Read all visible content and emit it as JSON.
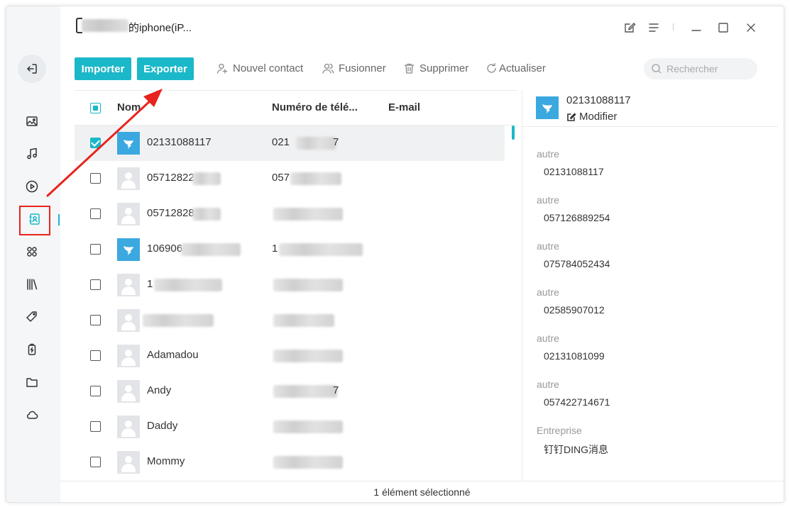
{
  "title": {
    "device_name": "的iphone(iP..."
  },
  "toolbar": {
    "import_label": "Importer",
    "export_label": "Exporter",
    "new_contact_label": "Nouvel contact",
    "merge_label": "Fusionner",
    "delete_label": "Supprimer",
    "refresh_label": "Actualiser",
    "search_placeholder": "Rechercher"
  },
  "sidebar": {
    "items": [
      {
        "icon": "back-icon"
      },
      {
        "icon": "photos-icon"
      },
      {
        "icon": "music-icon"
      },
      {
        "icon": "video-icon"
      },
      {
        "icon": "contacts-icon",
        "active": true
      },
      {
        "icon": "apps-icon"
      },
      {
        "icon": "books-icon"
      },
      {
        "icon": "ringtone-icon"
      },
      {
        "icon": "battery-icon"
      },
      {
        "icon": "folder-icon"
      },
      {
        "icon": "cloud-icon"
      }
    ]
  },
  "list": {
    "headers": {
      "name": "Nom",
      "phone": "Numéro de télé...",
      "email": "E-mail"
    },
    "rows": [
      {
        "name": "02131088117",
        "phone": "021",
        "phone_tail": "7",
        "checked": true,
        "avatar": "brand"
      },
      {
        "name": "05712822",
        "phone": "057",
        "phone_tail": "",
        "checked": false,
        "avatar": "default"
      },
      {
        "name": "05712828",
        "phone": "",
        "phone_tail": "",
        "checked": false,
        "avatar": "default"
      },
      {
        "name": "106906",
        "phone": "1",
        "phone_tail": "",
        "checked": false,
        "avatar": "brand"
      },
      {
        "name": "1",
        "phone": "",
        "phone_tail": "",
        "checked": false,
        "avatar": "default"
      },
      {
        "name": "",
        "phone": "",
        "phone_tail": "",
        "checked": false,
        "avatar": "default"
      },
      {
        "name": "Adamadou",
        "phone": "",
        "phone_tail": "",
        "checked": false,
        "avatar": "default"
      },
      {
        "name": "Andy",
        "phone": "",
        "phone_tail": "7",
        "checked": false,
        "avatar": "default"
      },
      {
        "name": "Daddy",
        "phone": "",
        "phone_tail": "",
        "checked": false,
        "avatar": "default"
      },
      {
        "name": "Mommy",
        "phone": "",
        "phone_tail": "",
        "checked": false,
        "avatar": "default"
      }
    ]
  },
  "detail": {
    "number": "02131088117",
    "edit_label": "Modifier",
    "fields": [
      {
        "label": "autre",
        "value": "02131088117"
      },
      {
        "label": "autre",
        "value": "057126889254"
      },
      {
        "label": "autre",
        "value": "075784052434"
      },
      {
        "label": "autre",
        "value": "02585907012"
      },
      {
        "label": "autre",
        "value": "02131081099"
      },
      {
        "label": "autre",
        "value": "057422714671"
      },
      {
        "label": "Entreprise",
        "value": "钉钉DING消息"
      }
    ]
  },
  "status": {
    "text": "1 élément sélectionné"
  },
  "colors": {
    "accent": "#1ab8c8",
    "annotation": "#e8231d",
    "brand_avatar": "#3ba8e0"
  }
}
